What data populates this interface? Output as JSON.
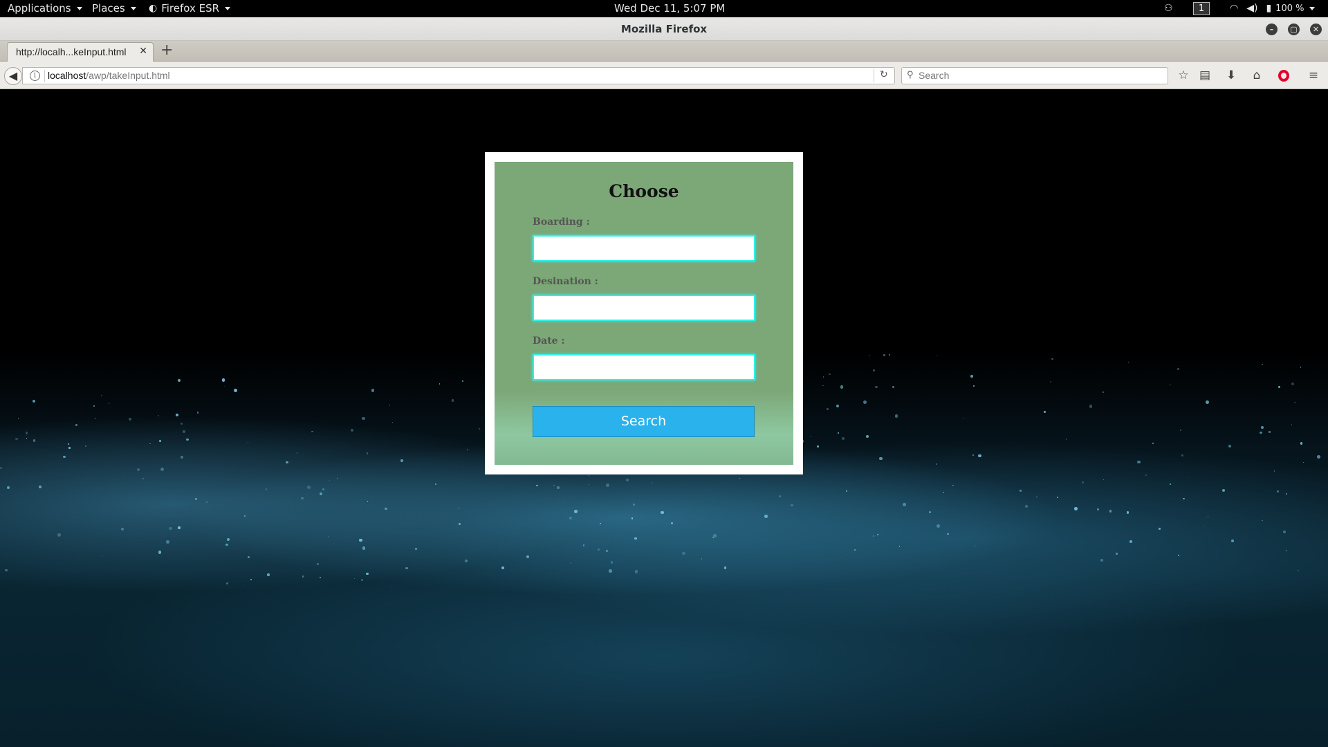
{
  "topbar": {
    "applications": "Applications",
    "places": "Places",
    "firefox": "Firefox ESR",
    "clock": "Wed Dec 11,  5:07 PM",
    "workspace": "1",
    "battery": "100 %"
  },
  "window": {
    "title": "Mozilla Firefox"
  },
  "tab": {
    "label": "http://localh...keInput.html"
  },
  "navbar": {
    "url_host": "localhost",
    "url_path": "/awp/takeInput.html",
    "search_placeholder": "Search"
  },
  "form": {
    "title": "Choose",
    "boarding_label": "Boarding :",
    "boarding_value": "",
    "destination_label": "Desination :",
    "destination_value": "",
    "date_label": "Date :",
    "date_value": "",
    "submit_label": "Search"
  },
  "colors": {
    "card_bg": "#7ca777",
    "input_border": "#2ff0e6",
    "button_bg": "#29b2ec"
  }
}
